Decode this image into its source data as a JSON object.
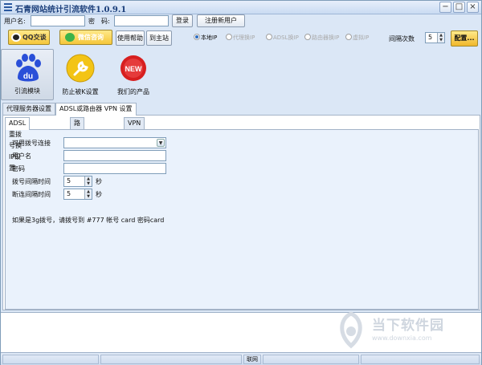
{
  "window": {
    "title": "石青网站统计引流软件1.0.9.1",
    "minimize": "−",
    "maximize": "□",
    "close": "×"
  },
  "login": {
    "username_label": "用户名:",
    "username_value": "",
    "password_label": "密　码:",
    "password_value": "",
    "login_button": "登录",
    "register_button": "注册新用户"
  },
  "toolbar": {
    "qq_button": "QQ交谈",
    "wechat_button": "微信咨询",
    "help_button": "使用帮助",
    "site_button": "到主站",
    "ip_modes": [
      {
        "label": "本地IP",
        "selected": true
      },
      {
        "label": "代理换IP",
        "selected": false
      },
      {
        "label": "ADSL换IP",
        "selected": false
      },
      {
        "label": "路由器换IP",
        "selected": false
      },
      {
        "label": "虚拟IP",
        "selected": false
      }
    ],
    "interval_label": "间隔次数",
    "interval_value": "5",
    "config_button": "配置..."
  },
  "modules": [
    {
      "label": "引流模块",
      "icon": "baidu-paw-icon",
      "active": true
    },
    {
      "label": "防止被K设置",
      "icon": "wrench-icon",
      "active": false
    },
    {
      "label": "我们的产品",
      "icon": "new-badge-icon",
      "active": false
    }
  ],
  "tabs": {
    "outer": [
      "代理服务器设置",
      "ADSL或路由器 VPN 设置"
    ],
    "inner": [
      "ADSL重拨号换IP设置",
      "路由器换IP设置",
      "VPN换IP设置"
    ]
  },
  "adsl_form": {
    "connection_label": "可用拨号连接",
    "connection_value": "",
    "username_label": "用户名",
    "username_value": "",
    "password_label": "密码",
    "password_value": "",
    "dial_interval_label": "拨号间隔时间",
    "dial_interval_value": "5",
    "dial_interval_unit": "秒",
    "disconnect_interval_label": "断连间隔时间",
    "disconnect_interval_value": "5",
    "disconnect_interval_unit": "秒",
    "note": "如果是3g拨号，请拨号到 #777 帐号 card 密码card"
  },
  "statusbar": {
    "network": "联网"
  },
  "watermark": {
    "title": "当下软件园",
    "url": "www.downxia.com"
  },
  "colors": {
    "accent": "#2d6ec2",
    "yellow_button": "#f5c63a",
    "window_bg": "#dbe7f6"
  }
}
